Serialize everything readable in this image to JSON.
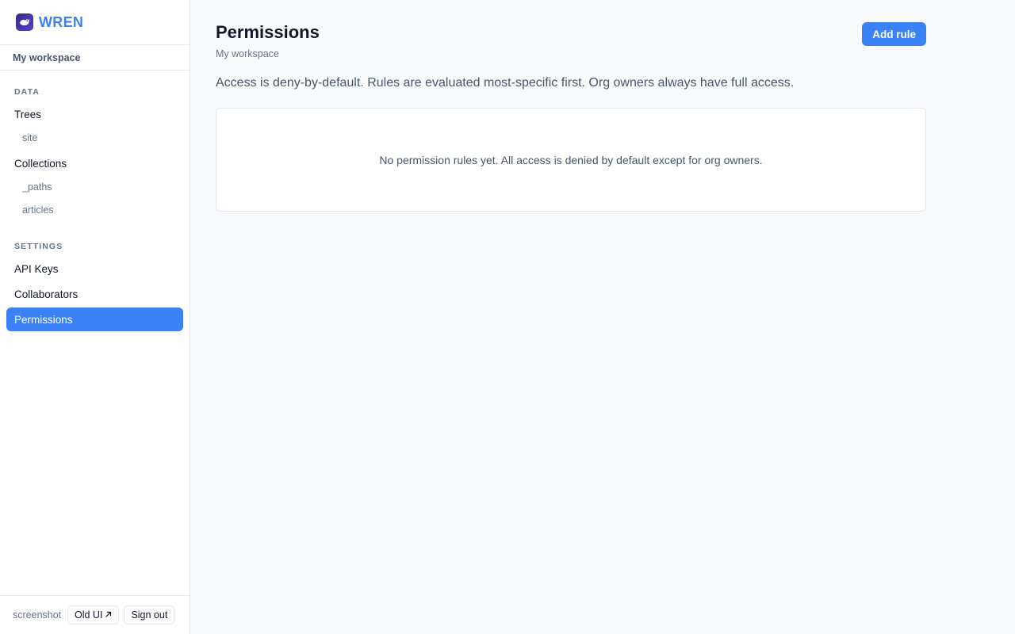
{
  "brand": {
    "name": "WREN",
    "logo_icon": "bird-logo-icon"
  },
  "workspace": {
    "name": "My workspace"
  },
  "sidebar": {
    "data_section": {
      "title": "DATA",
      "trees_label": "Trees",
      "trees": [
        "site"
      ],
      "collections_label": "Collections",
      "collections": [
        "_paths",
        "articles"
      ]
    },
    "settings_section": {
      "title": "SETTINGS",
      "items": [
        "API Keys",
        "Collaborators",
        "Permissions"
      ],
      "active": "Permissions"
    }
  },
  "footer": {
    "user": "screenshot",
    "old_ui_label": "Old UI",
    "old_ui_icon": "external-arrow-icon",
    "sign_out_label": "Sign out"
  },
  "page": {
    "title": "Permissions",
    "subtitle": "My workspace",
    "add_button_label": "Add rule",
    "description": "Access is deny-by-default. Rules are evaluated most-specific first. Org owners always have full access.",
    "empty_state": "No permission rules yet. All access is denied by default except for org owners."
  },
  "colors": {
    "accent": "#3b82f6",
    "text": "#0f172a",
    "muted": "#64748b",
    "border": "#e5e7eb",
    "background": "#f8fafc"
  }
}
